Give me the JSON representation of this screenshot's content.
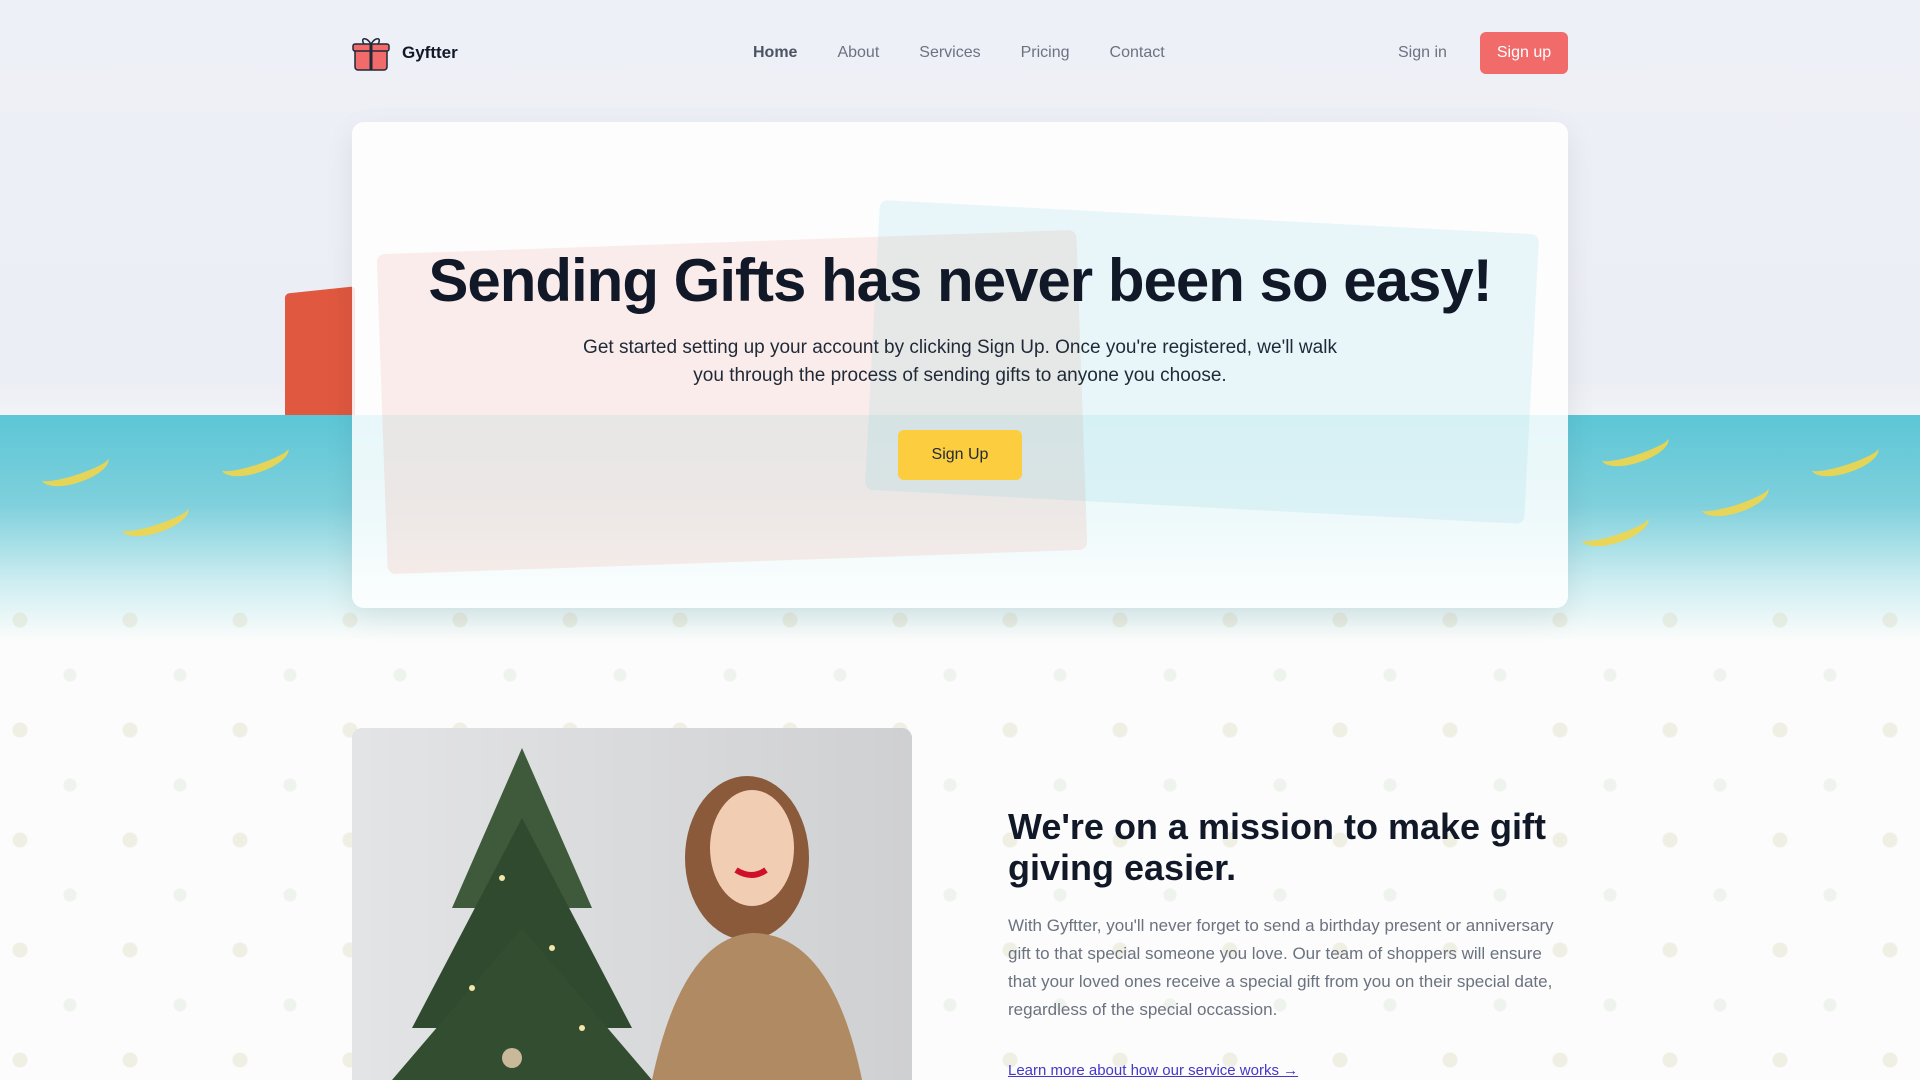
{
  "brand": {
    "name": "Gyftter",
    "logo_icon": "gift-icon"
  },
  "nav": {
    "items": [
      {
        "label": "Home",
        "active": true
      },
      {
        "label": "About",
        "active": false
      },
      {
        "label": "Services",
        "active": false
      },
      {
        "label": "Pricing",
        "active": false
      },
      {
        "label": "Contact",
        "active": false
      }
    ]
  },
  "auth": {
    "sign_in": "Sign in",
    "sign_up": "Sign up"
  },
  "hero": {
    "title": "Sending Gifts has never been so easy!",
    "subtitle": "Get started setting up your account by clicking Sign Up. Once you're registered, we'll walk you through the process of sending gifts to anyone you choose.",
    "cta": "Sign Up"
  },
  "mission": {
    "title": "We're on a mission to make gift giving easier.",
    "text": "With Gyftter, you'll never forget to send a birthday present or anniversary gift to that special someone you love. Our team of shoppers will ensure that your loved ones receive a special gift from you on their special date, regardless of the special occassion.",
    "link": "Learn more about how our service works →"
  },
  "colors": {
    "accent_red": "#f26b6b",
    "accent_yellow": "#fccd3f",
    "link": "#4338ca",
    "wrapping_teal": "#5cc6d6"
  }
}
